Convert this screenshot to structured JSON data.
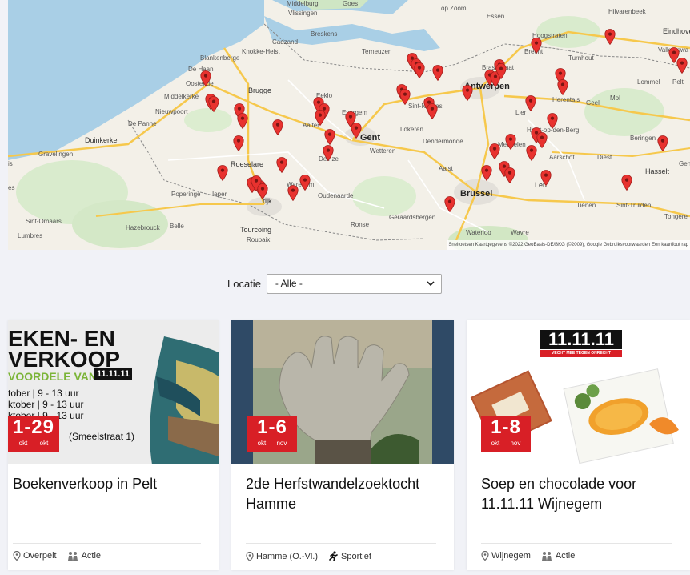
{
  "map": {
    "labels": {
      "middelburg": "Middelburg",
      "goes": "Goes",
      "vlissingen": "Vlissingen",
      "breskens": "Breskens",
      "cadzand": "Cadzand",
      "knokke": "Knokke-Heist",
      "blankenberge": "Blankenberge",
      "dehaan": "De Haan",
      "oostende": "Oostende",
      "middelkerke": "Middelkerke",
      "nieuwpoort": "Nieuwpoort",
      "depanne": "De Panne",
      "duinkerke": "Duinkerke",
      "gravelingen": "Gravelingen",
      "brugge": "Brugge",
      "eeklo": "Eeklo",
      "terneuzen": "Terneuzen",
      "evergem": "Evergem",
      "aalter": "Aalter",
      "gent": "Gent",
      "lokeren": "Lokeren",
      "wetteren": "Wetteren",
      "dendermonde": "Dendermonde",
      "deinze": "Deinze",
      "roeselare": "Roeselare",
      "waregem": "Waregem",
      "kortrijk": "rijk",
      "oudenaarde": "Oudenaarde",
      "poperinge": "Poperinge",
      "ieper": "Ieper",
      "aalst": "Aalst",
      "ronse": "Ronse",
      "geraardsbergen": "Geraardsbergen",
      "tourcoing": "Tourcoing",
      "roubaix": "Roubaix",
      "hazebrouck": "Hazebrouck",
      "belle": "Belle",
      "lumbres": "Lumbres",
      "sintomaars": "Sint-Omaars",
      "antwerpen": "Antwerpen",
      "brasschaat": "Brasschaat",
      "brecht": "Brecht",
      "hoogstraten": "Hoogstraten",
      "essen": "Essen",
      "turnhout": "Turnhout",
      "herentals": "Herentals",
      "geel": "Geel",
      "mol": "Mol",
      "lommel": "Lommel",
      "pelt": "Pelt",
      "lier": "Lier",
      "mechelen": "Mechelen",
      "heist": "Heist-op-den-Berg",
      "aarschot": "Aarschot",
      "diest": "Diest",
      "beringen": "Beringen",
      "hasselt": "Hasselt",
      "brussel": "Brussel",
      "leuven": "Leu",
      "tienen": "Tienen",
      "sinttruiden": "Sint-Truiden",
      "tongeren": "Tongere",
      "waterloo": "Waterloo",
      "wavre": "Wavre",
      "eindhoven": "Eindhove",
      "valkenswaard": "Valkenswa",
      "hilvarenbeek": "Hilvarenbeek",
      "opzoom": "op Zoom",
      "sintniklaas": "Sint-Niklaas",
      "is": "is",
      "es": "es",
      "gen": "Gen"
    },
    "attribution": "Sneltoetsen   Kaartgegevens ©2022 GeoBasis-DE/BKG (©2009), Google   Gebruiksvoorwaarden   Een kaartfout rap"
  },
  "filter": {
    "label": "Locatie",
    "selected": "- Alle -"
  },
  "cards": [
    {
      "title": "Boekenverkoop in Pelt",
      "location": "Overpelt",
      "category": "Actie",
      "date_range": "1-29",
      "month_start": "okt",
      "month_end": "okt",
      "poster_lines": [
        "EKEN- EN",
        "VERKOOP",
        "VOORDELE VAN"
      ],
      "poster_badge": "11.11.11",
      "poster_rows": [
        "tober | 9 - 13 uur",
        "ktober | 9 - 13 uur",
        "ktober | 9 - 13 uur"
      ],
      "poster_address": "(Smeelstraat 1)"
    },
    {
      "title": "2de Herfstwandelzoektocht Hamme",
      "location": "Hamme (O.-Vl.)",
      "category": "Sportief",
      "date_range": "1-6",
      "month_start": "okt",
      "month_end": "nov"
    },
    {
      "title": "Soep en chocolade voor 11.11.11 Wijnegem",
      "location": "Wijnegem",
      "category": "Actie",
      "date_range": "1-8",
      "month_start": "okt",
      "month_end": "nov",
      "poster_badge": "11.11.11",
      "poster_tagline": "VECHT MEE TEGEN ONRECHT"
    }
  ],
  "colors": {
    "accent_red": "#d81f26",
    "pin_red": "#e8322f",
    "map_land": "#f3f0e8",
    "map_water": "#a9cfe6",
    "map_green": "#cfe6c4"
  },
  "icons": {
    "location": "map-pin-icon",
    "action": "people-icon",
    "sport": "running-icon",
    "dropdown": "chevron-down-icon"
  }
}
